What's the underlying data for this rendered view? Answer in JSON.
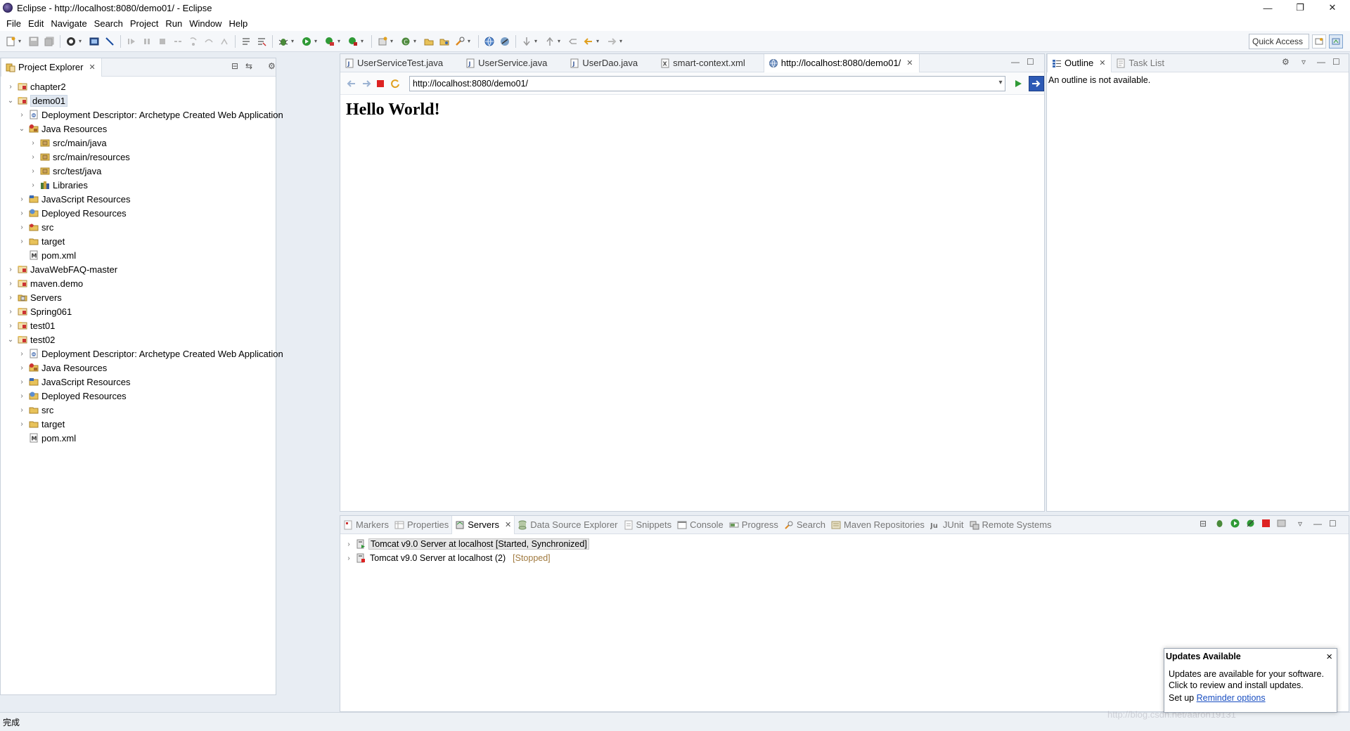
{
  "window": {
    "title": "Eclipse - http://localhost:8080/demo01/ - Eclipse",
    "minimize": "—",
    "restore": "❐",
    "close": "✕"
  },
  "menu": [
    "File",
    "Edit",
    "Navigate",
    "Search",
    "Project",
    "Run",
    "Window",
    "Help"
  ],
  "toolbar": {
    "quick_access": "Quick Access"
  },
  "explorer": {
    "tab_label": "Project Explorer",
    "tree": [
      {
        "label": "chapter2",
        "level": 0,
        "expanded": false,
        "icon": "project-icon"
      },
      {
        "label": "demo01",
        "level": 0,
        "expanded": true,
        "icon": "project-icon",
        "selected": true
      },
      {
        "label": "Deployment Descriptor: Archetype Created Web Application",
        "level": 1,
        "expanded": false,
        "icon": "descriptor-icon"
      },
      {
        "label": "Java Resources",
        "level": 1,
        "expanded": true,
        "icon": "java-resources-icon"
      },
      {
        "label": "src/main/java",
        "level": 2,
        "expanded": false,
        "icon": "package-folder-icon"
      },
      {
        "label": "src/main/resources",
        "level": 2,
        "expanded": false,
        "icon": "package-folder-icon"
      },
      {
        "label": "src/test/java",
        "level": 2,
        "expanded": false,
        "icon": "package-folder-icon"
      },
      {
        "label": "Libraries",
        "level": 2,
        "expanded": false,
        "icon": "libraries-icon"
      },
      {
        "label": "JavaScript Resources",
        "level": 1,
        "expanded": false,
        "icon": "js-resources-icon"
      },
      {
        "label": "Deployed Resources",
        "level": 1,
        "expanded": false,
        "icon": "deployed-icon"
      },
      {
        "label": "src",
        "level": 1,
        "expanded": false,
        "icon": "src-folder-icon"
      },
      {
        "label": "target",
        "level": 1,
        "expanded": false,
        "icon": "folder-icon"
      },
      {
        "label": "pom.xml",
        "level": 1,
        "expanded": null,
        "icon": "maven-file-icon"
      },
      {
        "label": "JavaWebFAQ-master",
        "level": 0,
        "expanded": false,
        "icon": "project-icon"
      },
      {
        "label": "maven.demo",
        "level": 0,
        "expanded": false,
        "icon": "project-icon"
      },
      {
        "label": "Servers",
        "level": 0,
        "expanded": false,
        "icon": "servers-folder-icon"
      },
      {
        "label": "Spring061",
        "level": 0,
        "expanded": false,
        "icon": "project-icon"
      },
      {
        "label": "test01",
        "level": 0,
        "expanded": false,
        "icon": "project-icon"
      },
      {
        "label": "test02",
        "level": 0,
        "expanded": true,
        "icon": "project-icon"
      },
      {
        "label": "Deployment Descriptor: Archetype Created Web Application",
        "level": 1,
        "expanded": false,
        "icon": "descriptor-icon"
      },
      {
        "label": "Java Resources",
        "level": 1,
        "expanded": false,
        "icon": "java-resources-icon"
      },
      {
        "label": "JavaScript Resources",
        "level": 1,
        "expanded": false,
        "icon": "js-resources-icon"
      },
      {
        "label": "Deployed Resources",
        "level": 1,
        "expanded": false,
        "icon": "deployed-icon"
      },
      {
        "label": "src",
        "level": 1,
        "expanded": false,
        "icon": "folder-icon"
      },
      {
        "label": "target",
        "level": 1,
        "expanded": false,
        "icon": "folder-icon"
      },
      {
        "label": "pom.xml",
        "level": 1,
        "expanded": null,
        "icon": "maven-file-icon"
      }
    ]
  },
  "editor": {
    "tabs": [
      {
        "label": "UserServiceTest.java",
        "icon": "java-file-icon",
        "active": false
      },
      {
        "label": "UserService.java",
        "icon": "java-file-icon",
        "active": false
      },
      {
        "label": "UserDao.java",
        "icon": "java-file-icon",
        "active": false
      },
      {
        "label": "smart-context.xml",
        "icon": "xml-file-icon",
        "active": false
      },
      {
        "label": "http://localhost:8080/demo01/",
        "icon": "globe-icon",
        "active": true
      }
    ],
    "url": "http://localhost:8080/demo01/",
    "page_heading": "Hello World!"
  },
  "outline": {
    "tabs": [
      {
        "label": "Outline",
        "active": true
      },
      {
        "label": "Task List",
        "active": false
      }
    ],
    "message": "An outline is not available."
  },
  "bottom": {
    "tabs": [
      {
        "label": "Markers",
        "active": false
      },
      {
        "label": "Properties",
        "active": false
      },
      {
        "label": "Servers",
        "active": true
      },
      {
        "label": "Data Source Explorer",
        "active": false
      },
      {
        "label": "Snippets",
        "active": false
      },
      {
        "label": "Console",
        "active": false
      },
      {
        "label": "Progress",
        "active": false
      },
      {
        "label": "Search",
        "active": false
      },
      {
        "label": "Maven Repositories",
        "active": false
      },
      {
        "label": "JUnit",
        "active": false
      },
      {
        "label": "Remote Systems",
        "active": false
      }
    ],
    "servers": [
      {
        "name": "Tomcat v9.0 Server at localhost",
        "status": "[Started, Synchronized]"
      },
      {
        "name": "Tomcat v9.0 Server at localhost (2)",
        "status": "[Stopped]"
      }
    ]
  },
  "status_bar": {
    "text": "完成"
  },
  "notification": {
    "title": "Updates Available",
    "close": "×",
    "line1": "Updates are available for your software.",
    "line2": "Click to review and install updates.",
    "setup_prefix": "Set up",
    "link": "Reminder options"
  },
  "watermark": "http://blog.csdn.net/aaron19131"
}
